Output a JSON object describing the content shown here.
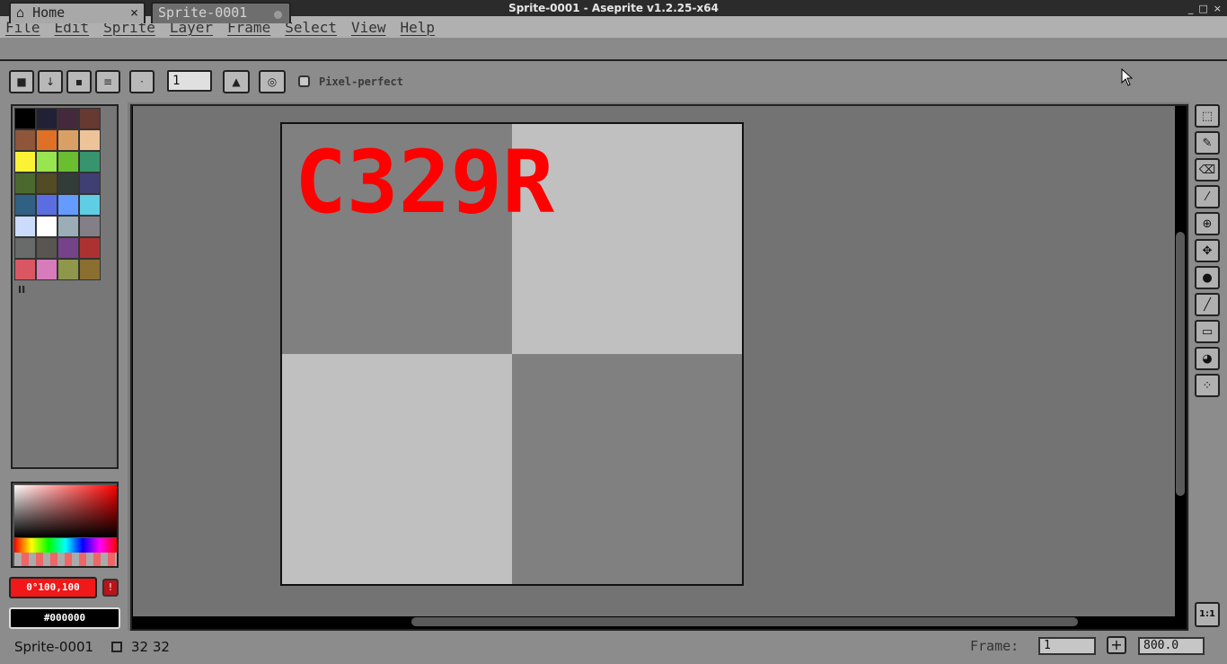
{
  "window": {
    "title": "Sprite-0001 - Aseprite v1.2.25-x64",
    "controls": [
      "_",
      "□",
      "×"
    ]
  },
  "menu": [
    "File",
    "Edit",
    "Sprite",
    "Layer",
    "Frame",
    "Select",
    "View",
    "Help"
  ],
  "tabs": [
    {
      "label": "Home",
      "icon": "home-icon",
      "close": "×"
    },
    {
      "label": "Sprite-0001",
      "icon": "modified-dot"
    }
  ],
  "toolbar": {
    "brush_size": "1",
    "pixel_perfect_label": "Pixel-perfect",
    "buttons": [
      "lock-icon",
      "arrow-down-icon",
      "square-brush-icon",
      "lines-icon",
      "dot-icon",
      "ink-icon",
      "pressure-icon"
    ]
  },
  "palette": {
    "colors": [
      "#000000",
      "#222034",
      "#45283c",
      "#663931",
      "#8f563b",
      "#df7126",
      "#d9a066",
      "#eec39a",
      "#fbf236",
      "#99e550",
      "#6abe30",
      "#37946e",
      "#4b692f",
      "#524b24",
      "#323c39",
      "#3f3f74",
      "#306082",
      "#5b6ee1",
      "#639bff",
      "#5fcde4",
      "#cbdbfc",
      "#ffffff",
      "#9badb7",
      "#847e87",
      "#696a6a",
      "#595652",
      "#76428a",
      "#ac3232",
      "#d95763",
      "#d77bba",
      "#8f974a",
      "#8a6f30"
    ],
    "pause_glyph": "II"
  },
  "colors": {
    "foreground_label": "0°100,100",
    "foreground_hex": "#f01818",
    "background_label": "#000000",
    "background_hex": "#000000"
  },
  "canvas": {
    "text": "C329R",
    "text_color": "#ff0000",
    "checker_light": "#c0c0c0",
    "checker_dark": "#808080"
  },
  "tools": [
    "marquee-icon",
    "pencil-icon",
    "eraser-icon",
    "eyedropper-icon",
    "zoom-icon",
    "move-icon",
    "paint-bucket-icon",
    "line-icon",
    "rectangle-icon",
    "contour-icon",
    "spray-icon"
  ],
  "zoom_button_label": "1:1",
  "status": {
    "sprite_name": "Sprite-0001",
    "dims": "32 32",
    "frame_label": "Frame:",
    "frame_value": "1",
    "add_frame": "+",
    "zoom": "800.0"
  }
}
